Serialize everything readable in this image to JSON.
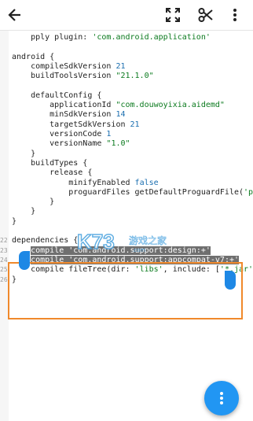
{
  "toolbar": {
    "back_icon": "arrow-left-icon",
    "fullscreen_icon": "fullscreen-icon",
    "cut_icon": "scissors-icon",
    "menu_icon": "more-vertical-icon"
  },
  "editor": {
    "lines": [
      {
        "num": "",
        "text": "    pply plugin: 'com.android.application'"
      },
      {
        "num": "",
        "text": ""
      },
      {
        "num": "",
        "text": "android {"
      },
      {
        "num": "",
        "text": "    compileSdkVersion 21"
      },
      {
        "num": "",
        "text": "    buildToolsVersion \"21.1.0\""
      },
      {
        "num": "",
        "text": ""
      },
      {
        "num": "",
        "text": "    defaultConfig {"
      },
      {
        "num": "",
        "text": "        applicationId \"com.douwoyixia.aidemd\""
      },
      {
        "num": "",
        "text": "        minSdkVersion 14"
      },
      {
        "num": "",
        "text": "        targetSdkVersion 21"
      },
      {
        "num": "",
        "text": "        versionCode 1"
      },
      {
        "num": "",
        "text": "        versionName \"1.0\""
      },
      {
        "num": "",
        "text": "    }"
      },
      {
        "num": "",
        "text": "    buildTypes {"
      },
      {
        "num": "",
        "text": "        release {"
      },
      {
        "num": "",
        "text": "            minifyEnabled false"
      },
      {
        "num": "",
        "text": "            proguardFiles getDefaultProguardFile('prog"
      },
      {
        "num": "",
        "text": "        }"
      },
      {
        "num": "",
        "text": "    }"
      },
      {
        "num": "",
        "text": "}"
      },
      {
        "num": "",
        "text": ""
      },
      {
        "num": "22",
        "text": "dependencies {"
      },
      {
        "num": "23",
        "text": "    compile 'com.android.support:design:+'"
      },
      {
        "num": "24",
        "text": "    compile 'com.android.support:appcompat-v7:+'"
      },
      {
        "num": "25",
        "text": "    compile fileTree(dir: 'libs', include: ['*.jar'])"
      },
      {
        "num": "26",
        "text": "}"
      }
    ]
  },
  "watermark": {
    "logo_text": "K73",
    "site_text": "游戏之家",
    "url_text": ".com"
  },
  "fab": {
    "icon": "more-vertical-icon"
  }
}
